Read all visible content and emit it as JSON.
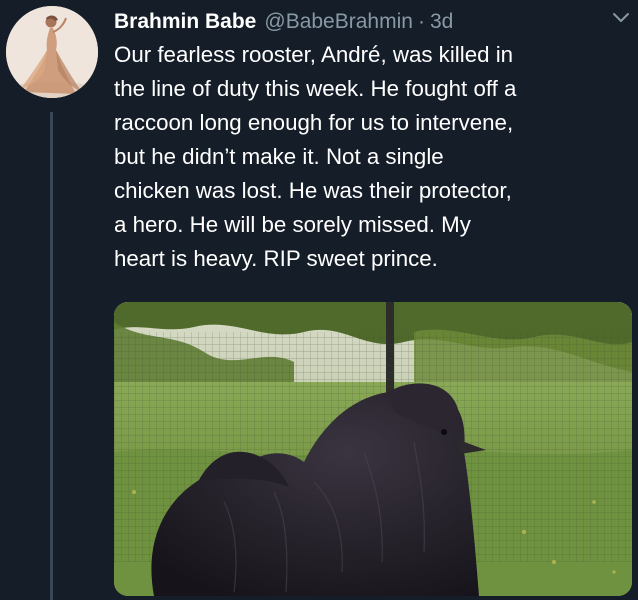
{
  "tweet": {
    "display_name": "Brahmin Babe",
    "handle": "@BabeBrahmin",
    "separator": "·",
    "timestamp": "3d",
    "text_lines": [
      "Our fearless rooster, André, was killed in",
      "the line of duty this week. He fought off a",
      "raccoon long enough for us to intervene,",
      "but he didn’t make it. Not a single",
      "chicken was lost. He was their protector,",
      "a hero. He will be sorely missed. My",
      "heart is heavy. RIP sweet prince."
    ],
    "icons": {
      "more_menu": "chevron-down-icon"
    },
    "colors": {
      "background": "#151d28",
      "primary_text": "#ffffff",
      "secondary_text": "#8899a6",
      "thread_line": "#3a4756"
    }
  }
}
